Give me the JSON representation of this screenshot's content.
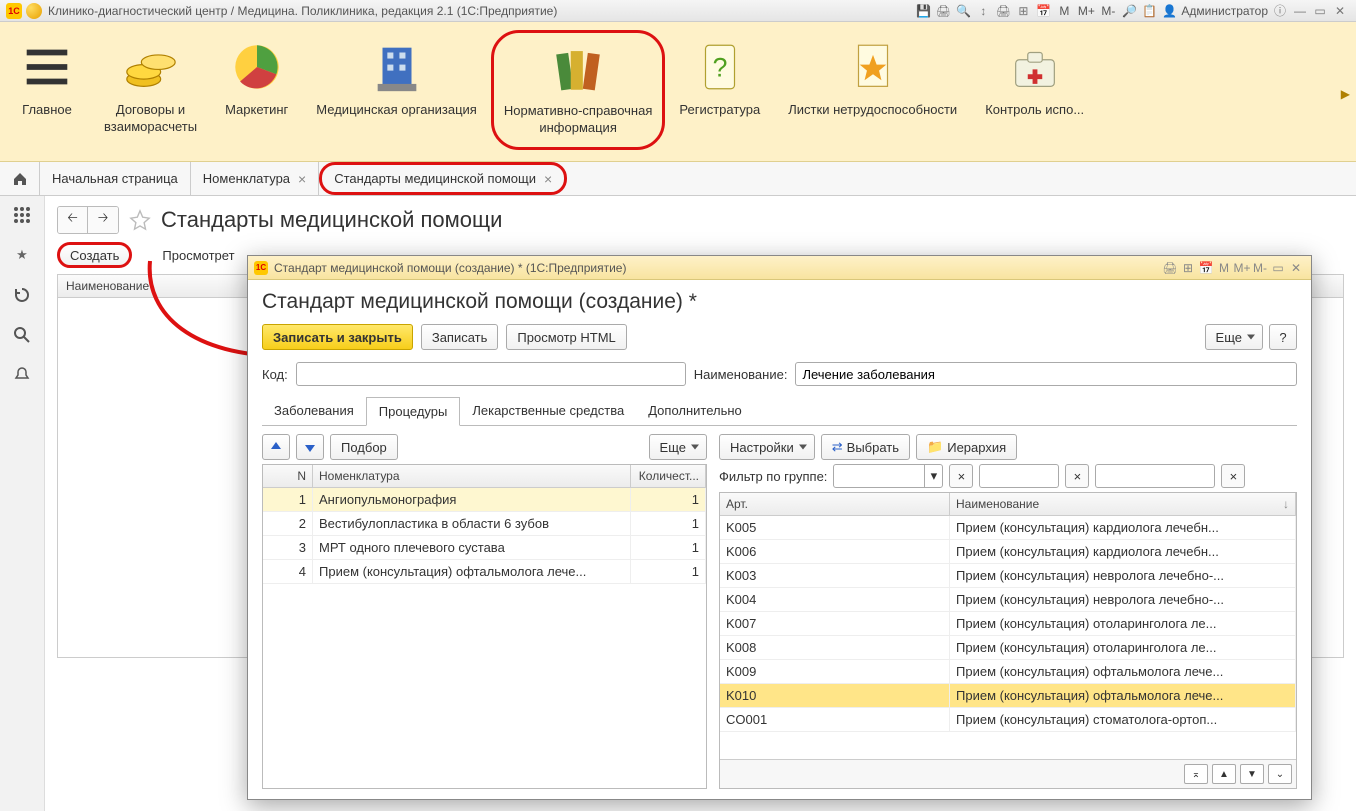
{
  "titlebar": {
    "text": "Клинико-диагностический центр / Медицина. Поликлиника, редакция 2.1  (1С:Предприятие)",
    "user": "Администратор",
    "mbtns": [
      "M",
      "M+",
      "M-"
    ]
  },
  "ribbon": {
    "items": [
      {
        "label": "Главное"
      },
      {
        "label": "Договоры и\nвзаиморасчеты"
      },
      {
        "label": "Маркетинг"
      },
      {
        "label": "Медицинская организация"
      },
      {
        "label": "Нормативно-справочная\nинформация",
        "highlight": true
      },
      {
        "label": "Регистратура"
      },
      {
        "label": "Листки нетрудоспособности"
      },
      {
        "label": "Контроль испо..."
      }
    ]
  },
  "tabs": [
    {
      "label": "Начальная страница",
      "closable": false
    },
    {
      "label": "Номенклатура",
      "closable": true
    },
    {
      "label": "Стандарты медицинской помощи",
      "closable": true,
      "highlight": true
    }
  ],
  "page": {
    "title": "Стандарты медицинской помощи",
    "create_btn": "Создать",
    "view_btn": "Просмотрет",
    "list_header": "Наименование"
  },
  "dialog": {
    "title": "Стандарт медицинской помощи (создание) * (1С:Предприятие)",
    "heading": "Стандарт медицинской помощи (создание) *",
    "btns": {
      "save_close": "Записать и закрыть",
      "save": "Записать",
      "preview": "Просмотр HTML",
      "more": "Еще",
      "help": "?"
    },
    "fields": {
      "code_lbl": "Код:",
      "code_val": "",
      "name_lbl": "Наименование:",
      "name_val": "Лечение заболевания"
    },
    "subtabs": [
      "Заболевания",
      "Процедуры",
      "Лекарственные средства",
      "Дополнительно"
    ],
    "active_subtab": 1,
    "left_toolbar": {
      "podbor": "Подбор",
      "more": "Еще"
    },
    "left_columns": {
      "n": "N",
      "nom": "Номенклатура",
      "qty": "Количест..."
    },
    "left_rows": [
      {
        "n": 1,
        "nom": "Ангиопульмонография",
        "qty": 1
      },
      {
        "n": 2,
        "nom": "Вестибулопластика в области 6 зубов",
        "qty": 1
      },
      {
        "n": 3,
        "nom": "МРТ одного плечевого сустава",
        "qty": 1
      },
      {
        "n": 4,
        "nom": "Прием (консультация) офтальмолога лече...",
        "qty": 1
      }
    ],
    "right_toolbar": {
      "settings": "Настройки",
      "choose": "Выбрать",
      "hierarchy": "Иерархия"
    },
    "filter": {
      "label": "Фильтр по группе:"
    },
    "right_columns": {
      "art": "Арт.",
      "name": "Наименование"
    },
    "right_rows": [
      {
        "art": "K005",
        "name": "Прием (консультация) кардиолога лечебн..."
      },
      {
        "art": "K006",
        "name": "Прием (консультация) кардиолога лечебн..."
      },
      {
        "art": "K003",
        "name": "Прием (консультация) невролога лечебно-..."
      },
      {
        "art": "K004",
        "name": "Прием (консультация) невролога лечебно-..."
      },
      {
        "art": "K007",
        "name": "Прием (консультация) отоларинголога ле..."
      },
      {
        "art": "K008",
        "name": "Прием (консультация) отоларинголога ле..."
      },
      {
        "art": "K009",
        "name": "Прием (консультация) офтальмолога лече..."
      },
      {
        "art": "K010",
        "name": "Прием (консультация) офтальмолога лече...",
        "highlight": true
      },
      {
        "art": "CO001",
        "name": "Прием (консультация) стоматолога-ортоп..."
      }
    ]
  }
}
